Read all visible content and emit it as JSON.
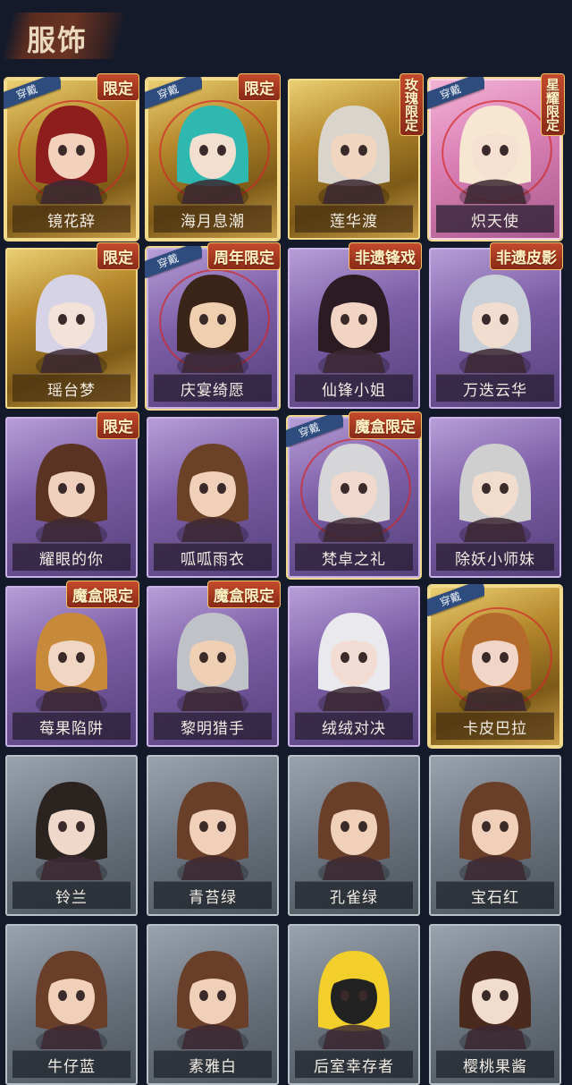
{
  "header": {
    "title": "服饰"
  },
  "equipped_label": "穿戴",
  "cards": [
    {
      "name": "镜花辞",
      "rarity": "gold",
      "equipped": true,
      "tag": "限定",
      "hair": "#8e1e1e",
      "skin": "#f2d2bd"
    },
    {
      "name": "海月息潮",
      "rarity": "gold",
      "equipped": true,
      "tag": "限定",
      "hair": "#2fb8b0",
      "skin": "#f3dfd0"
    },
    {
      "name": "莲华渡",
      "rarity": "gold",
      "equipped": false,
      "tag": "玫瑰限定",
      "hair": "#d9d4cc",
      "skin": "#f0d6c0"
    },
    {
      "name": "炽天使",
      "rarity": "pink",
      "equipped": true,
      "tag": "星耀限定",
      "hair": "#f6e6d2",
      "skin": "#f6e0d2"
    },
    {
      "name": "瑶台梦",
      "rarity": "gold",
      "equipped": false,
      "tag": "限定",
      "hair": "#d7d3e6",
      "skin": "#f2e2d8"
    },
    {
      "name": "庆宴绮愿",
      "rarity": "purple",
      "equipped": true,
      "tag": "周年限定",
      "hair": "#3a2418",
      "skin": "#f0cfb0"
    },
    {
      "name": "仙锋小姐",
      "rarity": "purple",
      "equipped": false,
      "tag": "非遗锋戏",
      "hair": "#2b1c24",
      "skin": "#f1d4c4"
    },
    {
      "name": "万迭云华",
      "rarity": "purple",
      "equipped": false,
      "tag": "非遗皮影",
      "hair": "#c9cfd6",
      "skin": "#f1dcd0"
    },
    {
      "name": "耀眼的你",
      "rarity": "purple",
      "equipped": false,
      "tag": "限定",
      "hair": "#5a3322",
      "skin": "#f0d1bd"
    },
    {
      "name": "呱呱雨衣",
      "rarity": "purple",
      "equipped": false,
      "tag": "",
      "hair": "#6b4128",
      "skin": "#f0d0b8"
    },
    {
      "name": "梵卓之礼",
      "rarity": "purple",
      "equipped": true,
      "tag": "魔盒限定",
      "hair": "#d6d6d8",
      "skin": "#f1d8cc"
    },
    {
      "name": "除妖小师妹",
      "rarity": "purple",
      "equipped": false,
      "tag": "",
      "hair": "#cfcfd0",
      "skin": "#f1dccd"
    },
    {
      "name": "莓果陷阱",
      "rarity": "purple",
      "equipped": false,
      "tag": "魔盒限定",
      "hair": "#c78a3a",
      "skin": "#f1d6c4"
    },
    {
      "name": "黎明猎手",
      "rarity": "purple",
      "equipped": false,
      "tag": "魔盒限定",
      "hair": "#bfc3c8",
      "skin": "#efd0b4"
    },
    {
      "name": "绒绒对决",
      "rarity": "purple",
      "equipped": false,
      "tag": "",
      "hair": "#e9e9ee",
      "skin": "#f3dcd4"
    },
    {
      "name": "卡皮巴拉",
      "rarity": "gold",
      "equipped": true,
      "tag": "",
      "hair": "#b36a2b",
      "skin": "#f1d5c8"
    },
    {
      "name": "铃兰",
      "rarity": "gray",
      "equipped": false,
      "tag": "",
      "hair": "#2a2320",
      "skin": "#efd8c9"
    },
    {
      "name": "青苔绿",
      "rarity": "gray",
      "equipped": false,
      "tag": "",
      "hair": "#6a3f2a",
      "skin": "#f0d0b8"
    },
    {
      "name": "孔雀绿",
      "rarity": "gray",
      "equipped": false,
      "tag": "",
      "hair": "#6a3f2a",
      "skin": "#f0d0b8"
    },
    {
      "name": "宝石红",
      "rarity": "gray",
      "equipped": false,
      "tag": "",
      "hair": "#6a3f2a",
      "skin": "#f0d0b8"
    },
    {
      "name": "牛仔蓝",
      "rarity": "gray",
      "equipped": false,
      "tag": "",
      "hair": "#6a3f2a",
      "skin": "#f0d0b8"
    },
    {
      "name": "素雅白",
      "rarity": "gray",
      "equipped": false,
      "tag": "",
      "hair": "#6a3f2a",
      "skin": "#f0d0b8"
    },
    {
      "name": "后室幸存者",
      "rarity": "gray",
      "equipped": false,
      "tag": "",
      "hair": "#f2cf2a",
      "skin": "#222"
    },
    {
      "name": "樱桃果酱",
      "rarity": "gray",
      "equipped": false,
      "tag": "",
      "hair": "#4a2a1c",
      "skin": "#f2dccd"
    }
  ]
}
